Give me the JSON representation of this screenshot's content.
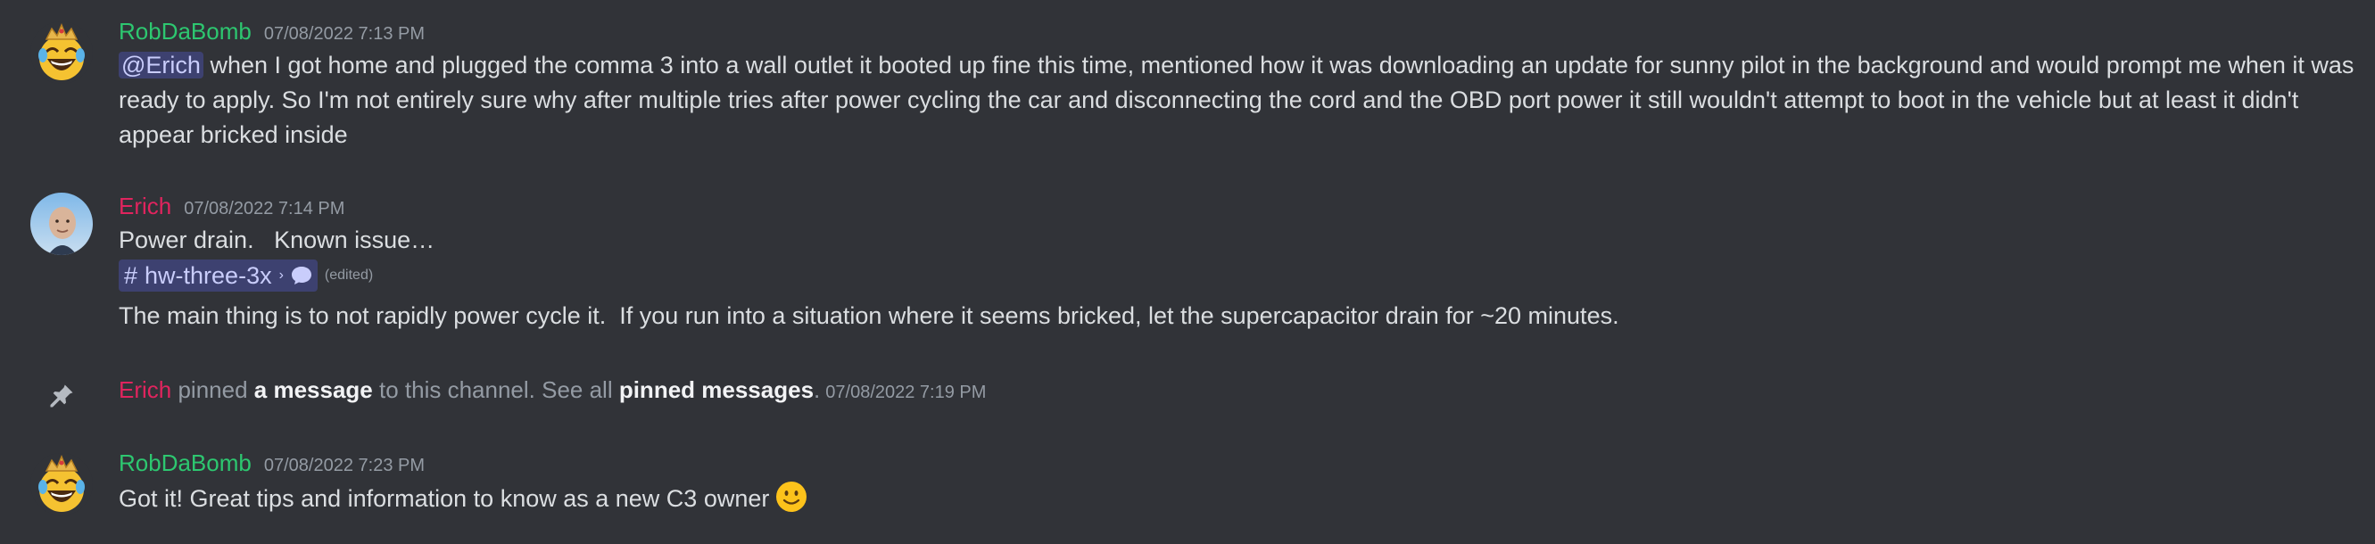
{
  "messages": [
    {
      "author": "RobDaBomb",
      "timestamp": "07/08/2022 7:13 PM",
      "mention": "@Erich",
      "text": " when I got home and plugged the comma 3 into a wall outlet it booted up fine this time, mentioned how it was downloading an update for sunny pilot in the background and would prompt me when it was ready to apply. So I'm not entirely sure why after multiple tries after power cycling the car and disconnecting the cord and the OBD port power it still wouldn't attempt to boot in the vehicle but at least it didn't appear bricked inside"
    },
    {
      "author": "Erich",
      "timestamp": "07/08/2022 7:14 PM",
      "line1": "Power drain.   Known issue…",
      "channel": {
        "hash": "#",
        "name": "hw-three-3x",
        "chevron": "›"
      },
      "edited": "(edited)",
      "line2": "The main thing is to not rapidly power cycle it.  If you run into a situation where it seems bricked, let the supercapacitor drain for ~20 minutes."
    },
    {
      "author": "RobDaBomb",
      "timestamp": "07/08/2022 7:23 PM",
      "text": "Got it! Great tips and information to know as a new C3 owner"
    }
  ],
  "system": {
    "actor": "Erich",
    "pinned": " pinned ",
    "a_message": "a message",
    "to_channel": " to this channel. See all ",
    "pinned_messages": "pinned messages",
    "period": ".",
    "timestamp": "07/08/2022 7:19 PM"
  },
  "colors": {
    "background": "#313338",
    "rob_name": "#2dc770",
    "erich_name": "#e0245e",
    "mention_bg": "rgba(88,101,242,0.3)",
    "muted": "#949ba4"
  },
  "icons": [
    "laughing-crown-emoji-avatar",
    "erich-photo-avatar",
    "pin-icon",
    "thread-bubble-icon",
    "slight-smile-emoji"
  ]
}
